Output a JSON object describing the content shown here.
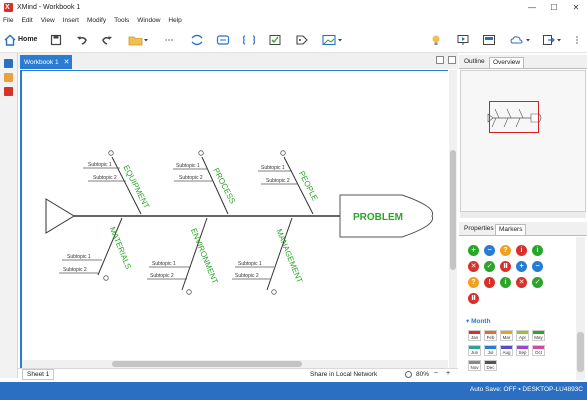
{
  "window": {
    "title": "XMind - Workbook 1",
    "controls": [
      "—",
      "☐",
      "✕"
    ]
  },
  "menu": [
    "File",
    "Edit",
    "View",
    "Insert",
    "Modify",
    "Tools",
    "Window",
    "Help"
  ],
  "toolbar": {
    "home_label": "Home"
  },
  "tabs": {
    "active_label": "Workbook 1",
    "close": "✕"
  },
  "diagram": {
    "head_label": "PROBLEM",
    "categories": [
      "EQUIPMENT",
      "PROCESS",
      "PEOPLE",
      "MATERIALS",
      "ENVIRONMENT",
      "MANAGEMENT"
    ],
    "subtopic_1": "Subtopic 1",
    "subtopic_2": "Subtopic 2",
    "colors": {
      "category_text": "#2aa52a",
      "head_text": "#2aa52a",
      "line": "#333333"
    }
  },
  "sheetbar": {
    "sheet_tab": "Sheet 1",
    "share": "Share in Local Network",
    "zoom": "80%",
    "zoom_minus": "−",
    "zoom_plus": "+"
  },
  "right_panel": {
    "top_tabs": [
      "Outline",
      "Overview"
    ],
    "bottom_tabs": [
      "Properties",
      "Markers"
    ],
    "month_heading": "Month",
    "months_row1": [
      "Jan",
      "Feb",
      "Mar",
      "Apr",
      "May"
    ],
    "months_row2": [
      "Jun",
      "Jul",
      "Aug",
      "Sep",
      "Oct"
    ],
    "months_row3": [
      "Nov",
      "Dec"
    ]
  },
  "statusbar": {
    "autosave": "Auto Save: OFF  ▪ DESKTOP-LU4893C"
  }
}
